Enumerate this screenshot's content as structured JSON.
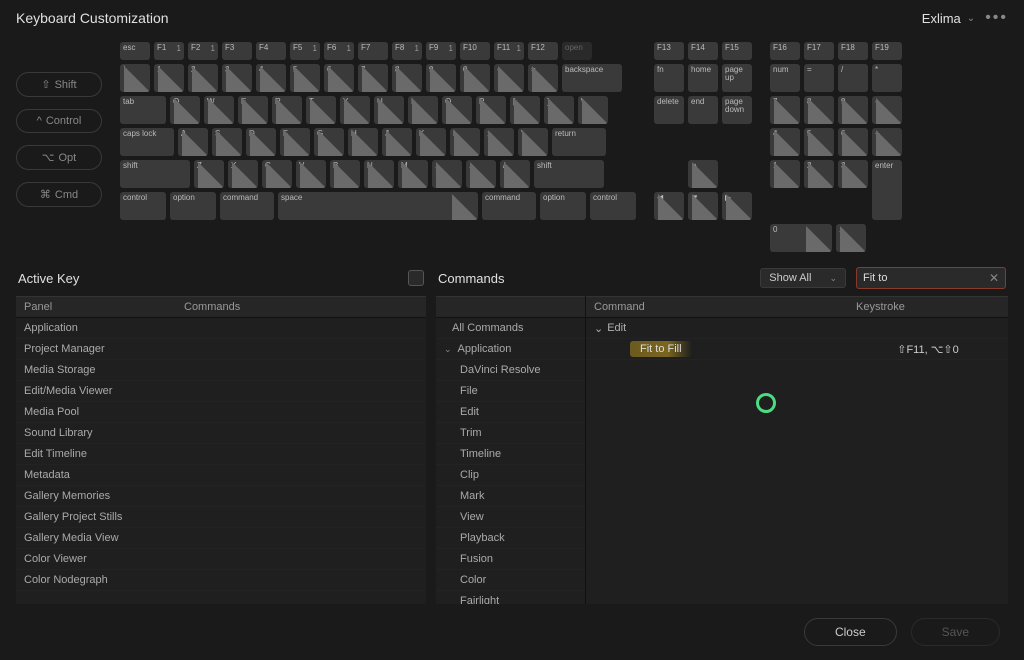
{
  "header": {
    "title": "Keyboard Customization",
    "preset": "Exlima"
  },
  "modifiers": [
    {
      "sym": "⇧",
      "label": "Shift"
    },
    {
      "sym": "^",
      "label": "Control"
    },
    {
      "sym": "⌥",
      "label": "Opt"
    },
    {
      "sym": "⌘",
      "label": "Cmd"
    }
  ],
  "fnrow": [
    "esc",
    "F1",
    "F2",
    "F3",
    "F4",
    "F5",
    "F6",
    "F7",
    "F8",
    "F9",
    "F10",
    "F11",
    "F12"
  ],
  "fnnums": [
    "",
    "1",
    "1",
    "",
    "",
    "1",
    "1",
    "",
    "1",
    "1",
    "",
    "1",
    ""
  ],
  "open_label": "open",
  "row1": [
    "`",
    "1",
    "2",
    "3",
    "4",
    "5",
    "6",
    "7",
    "8",
    "9",
    "0",
    "-",
    "="
  ],
  "backspace": "backspace",
  "row2_lead": "tab",
  "row2": [
    "Q",
    "W",
    "E",
    "R",
    "T",
    "Y",
    "U",
    "I",
    "O",
    "P",
    "[",
    "]",
    "\\"
  ],
  "row3_lead": "caps lock",
  "row3": [
    "A",
    "S",
    "D",
    "F",
    "G",
    "H",
    "J",
    "K",
    "L",
    ";",
    "'"
  ],
  "return": "return",
  "row4_lead": "shift",
  "row4": [
    "Z",
    "X",
    "C",
    "V",
    "B",
    "N",
    "M",
    ",",
    ".",
    "/"
  ],
  "row4_trail": "shift",
  "row5": [
    "control",
    "option",
    "command",
    "space",
    "command",
    "option",
    "control"
  ],
  "nav_top": [
    "F13",
    "F14",
    "F15"
  ],
  "nav1": [
    "fn",
    "home",
    "page up"
  ],
  "nav2": [
    "delete",
    "end",
    "page down"
  ],
  "arrows": {
    "up": "▲",
    "left": "◀",
    "down": "▼",
    "right": "▶"
  },
  "np_top": [
    "F16",
    "F17",
    "F18",
    "F19"
  ],
  "np1": [
    "num",
    "=",
    "/",
    "*"
  ],
  "np2": [
    "7",
    "8",
    "9",
    "-"
  ],
  "np3": [
    "4",
    "5",
    "6",
    "+"
  ],
  "np4": [
    "1",
    "2",
    "3"
  ],
  "np_enter": "enter",
  "np5": [
    "0",
    "."
  ],
  "active_key": {
    "title": "Active Key",
    "cols": [
      "Panel",
      "Commands"
    ],
    "rows": [
      "Application",
      "Project Manager",
      "Media Storage",
      "Edit/Media Viewer",
      "Media Pool",
      "Sound Library",
      "Edit Timeline",
      "Metadata",
      "Gallery Memories",
      "Gallery Project Stills",
      "Gallery Media View",
      "Color Viewer",
      "Color Nodegraph"
    ]
  },
  "commands": {
    "title": "Commands",
    "dropdown": "Show All",
    "search": "Fit to",
    "cols": [
      "Command",
      "Keystroke"
    ],
    "all": "All Commands",
    "tree_root": "Application",
    "tree": [
      "DaVinci Resolve",
      "File",
      "Edit",
      "Trim",
      "Timeline",
      "Clip",
      "Mark",
      "View",
      "Playback",
      "Fusion",
      "Color",
      "Fairlight"
    ],
    "result_group": "Edit",
    "result_item": "Fit to Fill",
    "result_keystroke": "⇧F11, ⌥⇧0"
  },
  "footer": {
    "close": "Close",
    "save": "Save"
  }
}
